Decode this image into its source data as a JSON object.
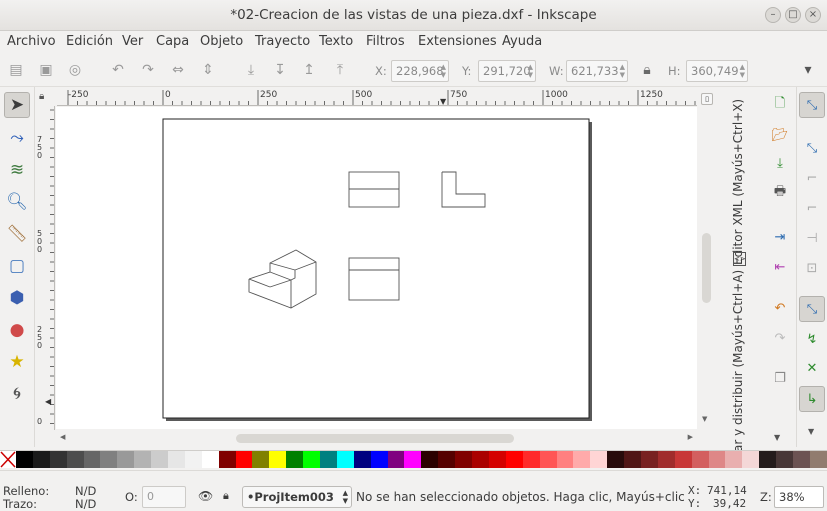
{
  "window": {
    "title": "*02-Creacion de las vistas de una pieza.dxf - Inkscape",
    "minimize": "–",
    "maximize": "□",
    "close": "×"
  },
  "menu": [
    "Archivo",
    "Edición",
    "Ver",
    "Capa",
    "Objeto",
    "Trayecto",
    "Texto",
    "Filtros",
    "Extensiones",
    "Ayuda"
  ],
  "toolbar": {
    "x_label": "X:",
    "x_value": "228,968",
    "y_label": "Y:",
    "y_value": "291,720",
    "w_label": "W:",
    "w_value": "621,733",
    "h_label": "H:",
    "h_value": "360,749",
    "more": "▾"
  },
  "ruler": {
    "h_ticks": [
      "-250",
      "0",
      "250",
      "500",
      "750",
      "1000",
      "1250"
    ],
    "v_ticks": [
      "7\n5\n0",
      "5\n0\n0",
      "2\n5\n0",
      "0"
    ]
  },
  "docks": {
    "xml_editor": "Editor XML (Mayús+Ctrl+X)",
    "align": "ar y distribuir (Mayús+Ctrl+A)"
  },
  "palette": [
    "#000000",
    "#1a1a1a",
    "#333333",
    "#4d4d4d",
    "#666666",
    "#808080",
    "#999999",
    "#b3b3b3",
    "#cccccc",
    "#e6e6e6",
    "#f2f2f2",
    "#ffffff",
    "#800000",
    "#ff0000",
    "#808000",
    "#ffff00",
    "#008000",
    "#00ff00",
    "#008080",
    "#00ffff",
    "#000080",
    "#0000ff",
    "#800080",
    "#ff00ff",
    "#2b0000",
    "#550000",
    "#800000",
    "#aa0000",
    "#d40000",
    "#ff0000",
    "#ff2a2a",
    "#ff5555",
    "#ff8080",
    "#ffaaaa",
    "#ffd5d5",
    "#280b0b",
    "#501616",
    "#782121",
    "#a02c2c",
    "#c83737",
    "#d35f5f",
    "#de8787",
    "#e9afaf",
    "#f4d7d7",
    "#241c1c",
    "#483737",
    "#6c5353",
    "#917c6f"
  ],
  "status": {
    "fill_label": "Relleno:",
    "fill_value": "N/D",
    "stroke_label": "Trazo:",
    "stroke_value": "N/D",
    "opacity_label": "O:",
    "opacity_value": "0",
    "layer": "•ProjItem003",
    "message": "No se han seleccionado objetos. Haga clic, Mayús+clic ...",
    "x_label": "X:",
    "x_value": "741,14",
    "y_label": "Y:",
    "y_value": "39,42",
    "zoom_label": "Z:",
    "zoom_value": "38%"
  },
  "colors": {
    "accent": "#4a90d9",
    "toggle_green": "#2e8b2e"
  }
}
